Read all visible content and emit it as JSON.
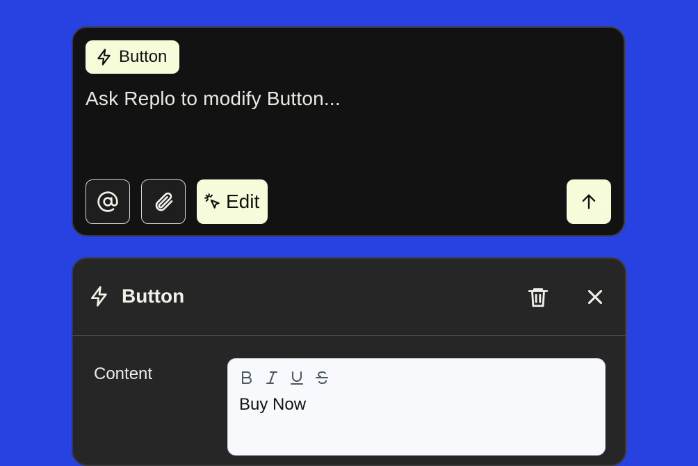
{
  "prompt": {
    "chip_label": "Button",
    "placeholder": "Ask Replo to modify Button...",
    "edit_label": "Edit",
    "icons": [
      "at-icon",
      "paperclip-icon",
      "cursor-click-icon",
      "arrow-up-icon",
      "bolt-icon"
    ]
  },
  "panel": {
    "title": "Button",
    "content_label": "Content",
    "content_value": "Buy Now",
    "toolbar": [
      "bold",
      "italic",
      "underline",
      "strikethrough"
    ]
  },
  "colors": {
    "background": "#2742e0",
    "card": "#121212",
    "panel": "#262626",
    "accent": "#f6fbd9"
  }
}
